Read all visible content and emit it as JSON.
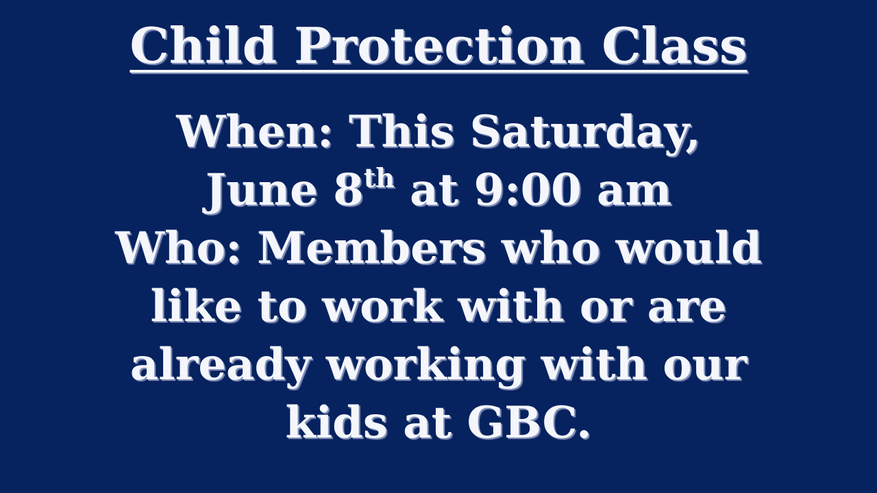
{
  "slide": {
    "title": "Child Protection Class",
    "when_line_1": "When: This Saturday,",
    "when_line_2_prefix": "June 8",
    "when_line_2_superscript": "th",
    "when_line_2_suffix": " at 9:00 am",
    "who_line_1": "Who: Members who would",
    "who_line_2": "like to work with or are",
    "who_line_3": "already working with our",
    "who_line_4": "kids at GBC."
  },
  "colors": {
    "background": "#06225f",
    "text": "#f4f6fb",
    "shadow_light": "#7f8fb8",
    "shadow_dark": "#22356d"
  }
}
